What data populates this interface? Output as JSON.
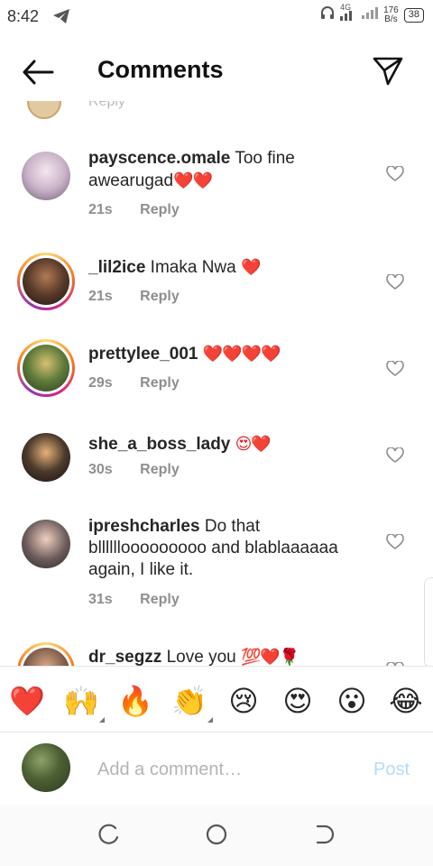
{
  "status_bar": {
    "time": "8:42",
    "network": "4G",
    "speed_value": "176",
    "speed_unit": "B/s",
    "battery": "38"
  },
  "header": {
    "title": "Comments"
  },
  "partial_comment": {
    "text": "Reply"
  },
  "comments": [
    {
      "username": "payscence.omale",
      "text": "Too fine awearugad",
      "emoji": "❤️❤️",
      "time": "21s",
      "reply": "Reply"
    },
    {
      "username": "_lil2ice",
      "text": "Imaka Nwa",
      "emoji": "❤️",
      "time": "21s",
      "reply": "Reply"
    },
    {
      "username": "prettylee_001",
      "text": "",
      "emoji": "❤️❤️❤️❤️",
      "time": "29s",
      "reply": "Reply"
    },
    {
      "username": "she_a_boss_lady",
      "text": "",
      "emoji": "😍❤️",
      "time": "30s",
      "reply": "Reply"
    },
    {
      "username": "ipreshcharles",
      "text": "Do that bllllllooooooooo and blablaaaaaa again, I like it.",
      "emoji": "",
      "time": "31s",
      "reply": "Reply"
    },
    {
      "username": "dr_segzz",
      "text": "Love you",
      "emoji": "💯❤️🌹",
      "time": "",
      "reply": ""
    }
  ],
  "emoji_bar": [
    "❤️",
    "🙌",
    "🔥",
    "👏",
    "😢",
    "😍",
    "😮",
    "😂"
  ],
  "composer": {
    "placeholder": "Add a comment…",
    "post_label": "Post"
  },
  "colors": {
    "heart": "#e0242a",
    "post_disabled": "#b3dbff",
    "meta_gray": "#8e8e8e"
  }
}
